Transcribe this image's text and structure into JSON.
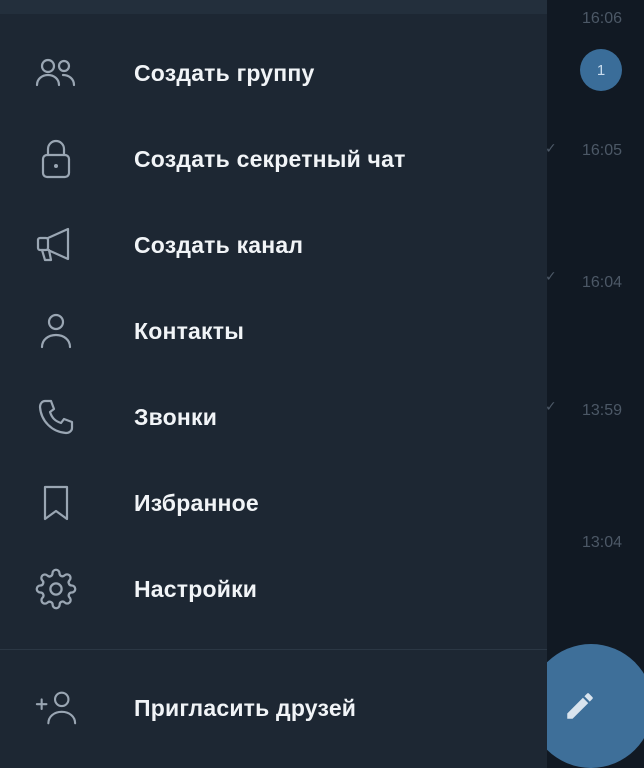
{
  "colors": {
    "drawer_bg": "#1d2733",
    "chatlist_bg": "#111923",
    "accent": "#3e6f99",
    "text_primary": "#f1f4f7",
    "icon_color": "#9aa6b3",
    "muted": "#4c5866"
  },
  "menu": {
    "items": [
      {
        "label": "Создать группу",
        "icon": "group-icon"
      },
      {
        "label": "Создать секретный чат",
        "icon": "lock-icon"
      },
      {
        "label": "Создать канал",
        "icon": "megaphone-icon"
      },
      {
        "label": "Контакты",
        "icon": "person-icon"
      },
      {
        "label": "Звонки",
        "icon": "phone-icon"
      },
      {
        "label": "Избранное",
        "icon": "bookmark-icon"
      },
      {
        "label": "Настройки",
        "icon": "gear-icon"
      }
    ],
    "invite": {
      "label": "Пригласить друзей",
      "icon": "add-person-icon"
    }
  },
  "chatlist": {
    "times": [
      "16:06",
      "16:05",
      "16:04",
      "13:59",
      "13:04"
    ],
    "unread_count": "1",
    "fab_icon": "pencil-icon"
  }
}
